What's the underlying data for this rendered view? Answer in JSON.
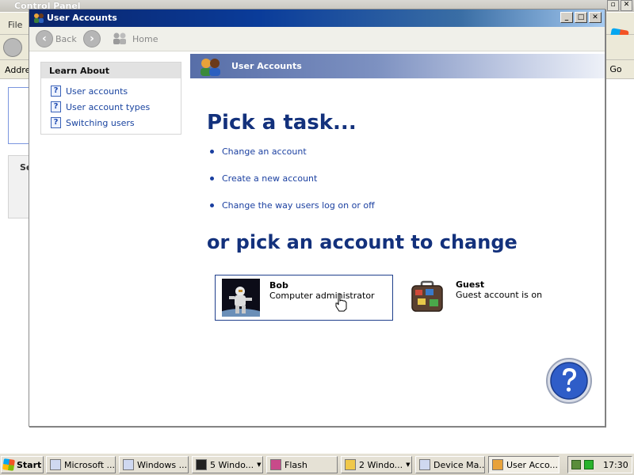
{
  "background_window": {
    "title": "Control Panel",
    "menu_first": "File",
    "address_label": "Addre",
    "go_label": "Go",
    "side_label": "Se"
  },
  "window": {
    "title": "User Accounts",
    "buttons": {
      "minimize": "_",
      "maximize": "□",
      "close": "✕"
    }
  },
  "nav": {
    "back": "Back",
    "home": "Home"
  },
  "learn_about": {
    "title": "Learn About",
    "items": [
      {
        "label": "User accounts"
      },
      {
        "label": "User account types"
      },
      {
        "label": "Switching users"
      }
    ]
  },
  "header": {
    "title": "User Accounts"
  },
  "tasks": {
    "title": "Pick a task...",
    "items": [
      {
        "label": "Change an account"
      },
      {
        "label": "Create a new account"
      },
      {
        "label": "Change the way users log on or off"
      }
    ]
  },
  "accounts": {
    "title": "or pick an account to change",
    "items": [
      {
        "name": "Bob",
        "detail": "Computer administrator"
      },
      {
        "name": "Guest",
        "detail": "Guest account is on"
      }
    ]
  },
  "taskbar": {
    "start": "Start",
    "items": [
      {
        "label": "Microsoft ..."
      },
      {
        "label": "Windows ..."
      },
      {
        "label": "5 Windo..."
      },
      {
        "label": "Flash"
      },
      {
        "label": "2 Windo..."
      },
      {
        "label": "Device Ma..."
      },
      {
        "label": "User Acco..."
      }
    ],
    "clock": "17:30"
  },
  "colors": {
    "title_blue": "#0a246a",
    "heading_blue": "#13317c",
    "link_blue": "#1a3fa0"
  }
}
